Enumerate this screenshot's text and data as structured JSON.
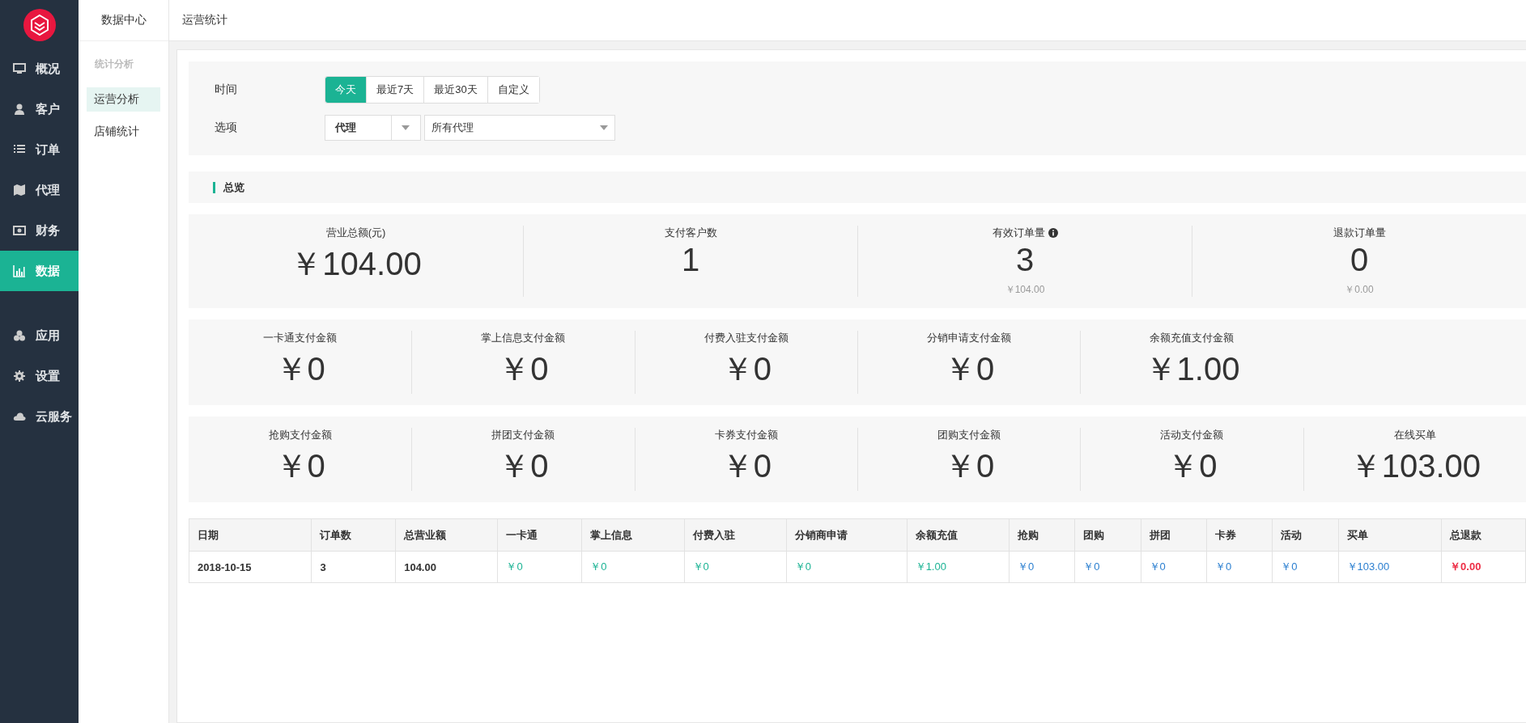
{
  "sidebar": {
    "main_items": [
      {
        "label": "概况",
        "selected": false
      },
      {
        "label": "客户",
        "selected": false
      },
      {
        "label": "订单",
        "selected": false
      },
      {
        "label": "代理",
        "selected": false
      },
      {
        "label": "财务",
        "selected": false
      },
      {
        "label": "数据",
        "selected": true
      }
    ],
    "extra_items": [
      {
        "label": "应用",
        "selected": false
      },
      {
        "label": "设置",
        "selected": false
      },
      {
        "label": "云服务",
        "selected": false
      }
    ]
  },
  "subnav": {
    "title": "数据中心",
    "section": "统计分析",
    "items": [
      {
        "label": "运营分析",
        "selected": true
      },
      {
        "label": "店铺统计",
        "selected": false
      }
    ]
  },
  "page_title": "运营统计",
  "filters": {
    "time_label": "时间",
    "ranges": [
      {
        "label": "今天",
        "selected": true
      },
      {
        "label": "最近7天",
        "selected": false
      },
      {
        "label": "最近30天",
        "selected": false
      },
      {
        "label": "自定义",
        "selected": false
      }
    ],
    "option_label": "选项",
    "type_select": "代理",
    "agent_select": "所有代理"
  },
  "overview": {
    "title": "总览",
    "rows": [
      [
        {
          "label": "营业总额(元)",
          "value": "￥104.00"
        },
        {
          "label": "支付客户数",
          "value": "1"
        },
        {
          "label": "有效订单量",
          "value": "3",
          "sub": "￥104.00",
          "info": true
        },
        {
          "label": "退款订单量",
          "value": "0",
          "sub": "￥0.00"
        }
      ],
      [
        {
          "label": "一卡通支付金额",
          "value": "￥0"
        },
        {
          "label": "掌上信息支付金额",
          "value": "￥0"
        },
        {
          "label": "付费入驻支付金额",
          "value": "￥0"
        },
        {
          "label": "分销申请支付金额",
          "value": "￥0"
        },
        {
          "label": "余额充值支付金额",
          "value": "￥1.00"
        }
      ],
      [
        {
          "label": "抢购支付金额",
          "value": "￥0"
        },
        {
          "label": "拼团支付金额",
          "value": "￥0"
        },
        {
          "label": "卡券支付金额",
          "value": "￥0"
        },
        {
          "label": "团购支付金额",
          "value": "￥0"
        },
        {
          "label": "活动支付金额",
          "value": "￥0"
        },
        {
          "label": "在线买单",
          "value": "￥103.00"
        }
      ]
    ]
  },
  "table": {
    "columns": [
      "日期",
      "订单数",
      "总营业额",
      "一卡通",
      "掌上信息",
      "付费入驻",
      "分销商申请",
      "余额充值",
      "抢购",
      "团购",
      "拼团",
      "卡券",
      "活动",
      "买单",
      "总退款"
    ],
    "rows": [
      [
        {
          "text": "2018-10-15",
          "kind": "bold"
        },
        {
          "text": "3",
          "kind": "bold"
        },
        {
          "text": "104.00",
          "kind": "bold"
        },
        {
          "text": "￥0",
          "kind": "teal"
        },
        {
          "text": "￥0",
          "kind": "teal"
        },
        {
          "text": "￥0",
          "kind": "teal"
        },
        {
          "text": "￥0",
          "kind": "teal"
        },
        {
          "text": "￥1.00",
          "kind": "teal"
        },
        {
          "text": "￥0",
          "kind": "blue"
        },
        {
          "text": "￥0",
          "kind": "blue"
        },
        {
          "text": "￥0",
          "kind": "blue"
        },
        {
          "text": "￥0",
          "kind": "blue"
        },
        {
          "text": "￥0",
          "kind": "blue"
        },
        {
          "text": "￥103.00",
          "kind": "blue"
        },
        {
          "text": "￥0.00",
          "kind": "red"
        }
      ]
    ]
  }
}
